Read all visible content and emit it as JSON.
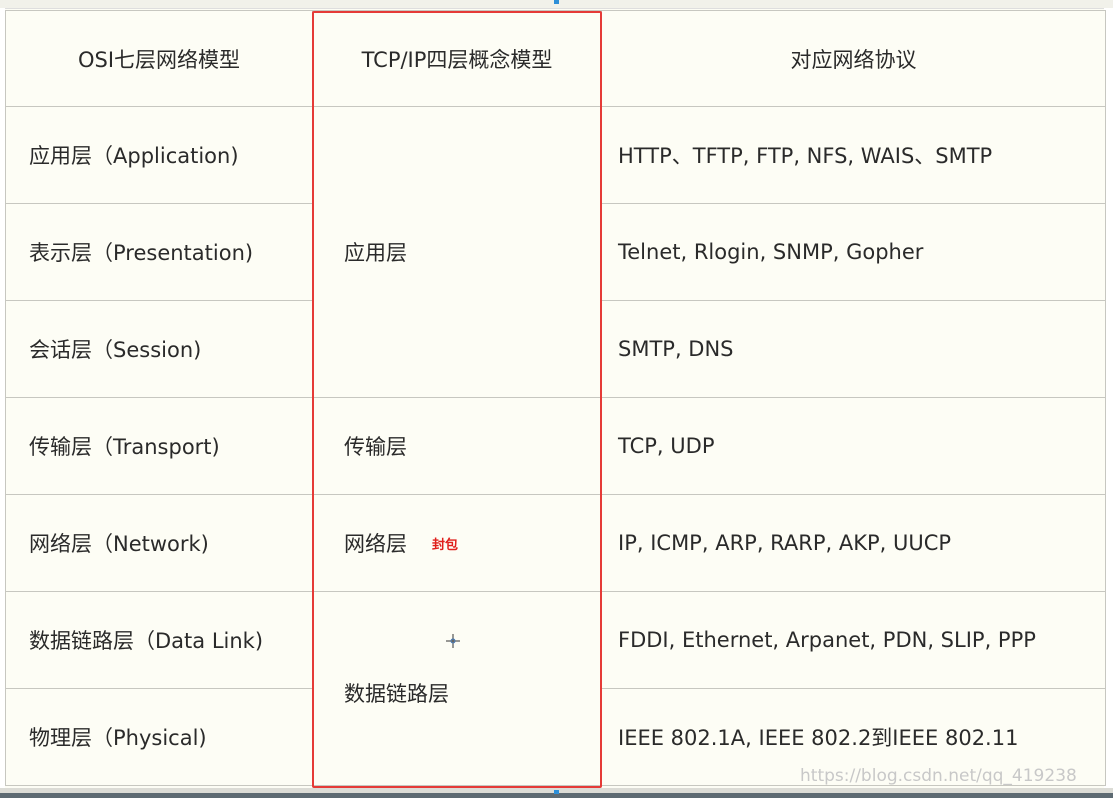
{
  "table": {
    "headers": [
      "OSI七层网络模型",
      "TCP/IP四层概念模型",
      "对应网络协议"
    ],
    "osi_layers": [
      "应用层（Application)",
      "表示层（Presentation)",
      "会话层（Session)",
      "传输层（Transport)",
      "网络层（Network)",
      "数据链路层（Data Link)",
      "物理层（Physical)"
    ],
    "tcpip_layers": [
      "应用层",
      "传输层",
      "网络层",
      "数据链路层"
    ],
    "protocols": [
      "HTTP、TFTP, FTP, NFS, WAIS、SMTP",
      "Telnet, Rlogin, SNMP, Gopher",
      "SMTP, DNS",
      "TCP, UDP",
      "IP, ICMP, ARP, RARP, AKP, UUCP",
      "FDDI, Ethernet, Arpanet, PDN, SLIP, PPP",
      "IEEE 802.1A, IEEE 802.2到IEEE 802.11"
    ]
  },
  "annotation": {
    "text": "封包",
    "color": "#e0201c"
  },
  "highlight": {
    "color": "#e53a37"
  },
  "cursor": {
    "icon": "crosshair-cursor-icon"
  },
  "watermark": "https://blog.csdn.net/qq_419238"
}
